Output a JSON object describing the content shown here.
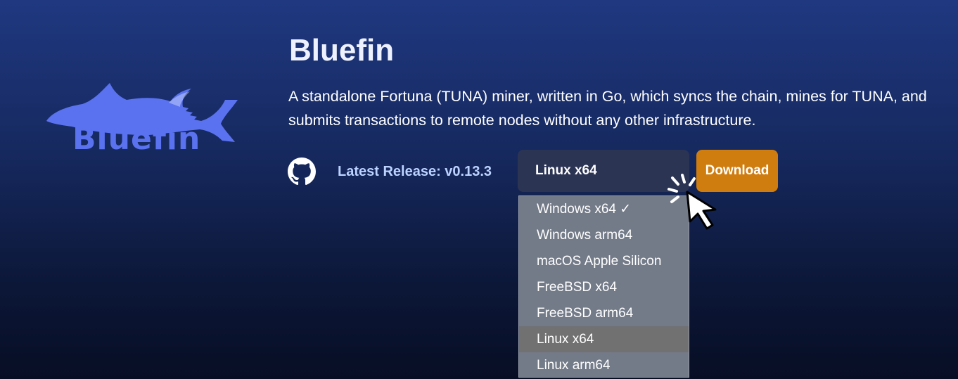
{
  "logo": {
    "wordmark": "Bluefin",
    "color": "#5a72f0"
  },
  "header": {
    "title": "Bluefin",
    "description": "A standalone Fortuna (TUNA) miner, written in Go, which syncs the chain, mines for TUNA, and submits transactions to remote nodes without any other infrastructure."
  },
  "release": {
    "github_icon": "github-icon",
    "label": "Latest Release: v0.13.3"
  },
  "platform_select": {
    "selected": "Linux x64",
    "options": [
      "Windows x64 ✓",
      "Windows arm64",
      "macOS Apple Silicon",
      "FreeBSD x64",
      "FreeBSD arm64",
      "Linux x64",
      "Linux arm64"
    ],
    "highlighted_option": "Linux x64"
  },
  "download": {
    "label": "Download",
    "color": "#d07d0f"
  },
  "cursor": {
    "icon": "click-pointer-icon"
  }
}
